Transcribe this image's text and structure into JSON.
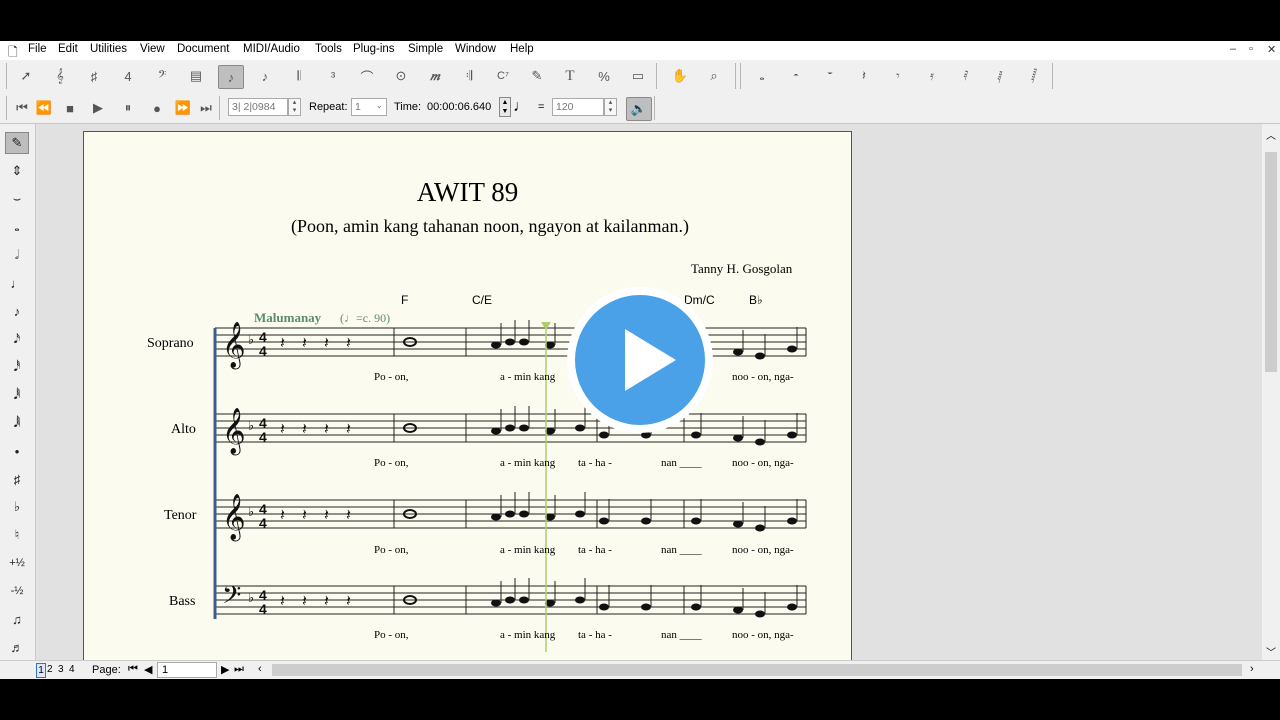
{
  "menu": [
    "File",
    "Edit",
    "Utilities",
    "View",
    "Document",
    "MIDI/Audio",
    "Tools",
    "Plug-ins",
    "Simple",
    "Window",
    "Help"
  ],
  "window_controls": [
    "‒",
    "▫",
    "✕"
  ],
  "toolbar1": {
    "tools": [
      "selection",
      "staff",
      "key-signature",
      "time-signature",
      "clef",
      "measure",
      "simple-entry",
      "speedy-entry",
      "tuplet",
      "smart-shape",
      "articulation",
      "expression",
      "repeat",
      "chord",
      "lyrics",
      "text",
      "resize",
      "page-layout",
      "hand-grabber",
      "zoom"
    ],
    "palette2": [
      "notehead",
      "eighth",
      "sixteenth",
      "quarter-rest",
      "eighth-rest",
      "16th-rest",
      "32nd-rest",
      "64th-rest",
      "128th-rest"
    ]
  },
  "transport": {
    "counter": "3| 2|0984",
    "repeat_label": "Repeat:",
    "repeat_value": "1",
    "time_label": "Time:",
    "time_value": "00:00:06.640",
    "equals": "=",
    "tempo": "120"
  },
  "left_palette": [
    "eraser",
    "flip",
    "tie",
    "whole",
    "half",
    "quarter",
    "eighth",
    "sixteenth",
    "32nd",
    "64th",
    "128th",
    "dot",
    "sharp",
    "flat",
    "natural",
    "half-step-up",
    "half-step-down",
    "voice",
    "tuplet-tool"
  ],
  "left_palette_text": {
    "half_up": "+½",
    "half_down": "-½"
  },
  "score": {
    "title": "AWIT 89",
    "subtitle": "(Poon, amin kang tahanan noon, ngayon at kailanman.)",
    "composer": "Tanny H. Gosgolan",
    "chords": [
      "F",
      "C/E",
      "Dm/C",
      "B♭"
    ],
    "tempo_text": "Malumanay",
    "tempo_mark": "(♩=c. 90)",
    "parts": [
      "Soprano",
      "Alto",
      "Tenor",
      "Bass"
    ],
    "lyrics": [
      [
        "Po - on,",
        "a - min kang",
        "",
        "noo - on,  nga-"
      ],
      [
        "Po - on,",
        "a - min kang",
        "ta - ha -",
        "nan ____",
        "noo - on,  nga-"
      ],
      [
        "Po - on,",
        "a - min kang",
        "ta - ha -",
        "nan ____",
        "noo - on,  nga-"
      ],
      [
        "Po - on,",
        "a - min kang",
        "ta - ha -",
        "nan ____",
        "noo - on,  nga-"
      ]
    ]
  },
  "statusbar": {
    "page_tabs": [
      "1",
      "2",
      "3",
      "4"
    ],
    "page_label": "Page:",
    "page_value": "1"
  },
  "colors": {
    "accent": "#4aa1e8",
    "paper": "#fcfbef",
    "tempo_text": "#5b8d6b",
    "playback_line": "#a9cf6a"
  }
}
